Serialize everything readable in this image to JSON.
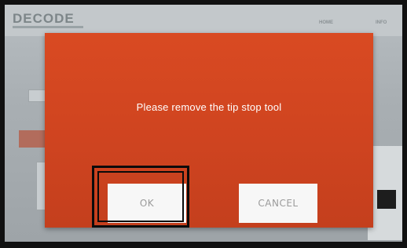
{
  "app": {
    "logo": "DECODE",
    "nav": [
      "HOME",
      "INFO"
    ]
  },
  "dialog": {
    "message": "Please remove the tip stop tool",
    "ok_label": "OK",
    "cancel_label": "CANCEL"
  },
  "colors": {
    "dialog_background": "#d24721",
    "button_background": "#f7f7f7",
    "button_text": "#9b9b9b",
    "highlight_border": "#0b0b0b"
  }
}
